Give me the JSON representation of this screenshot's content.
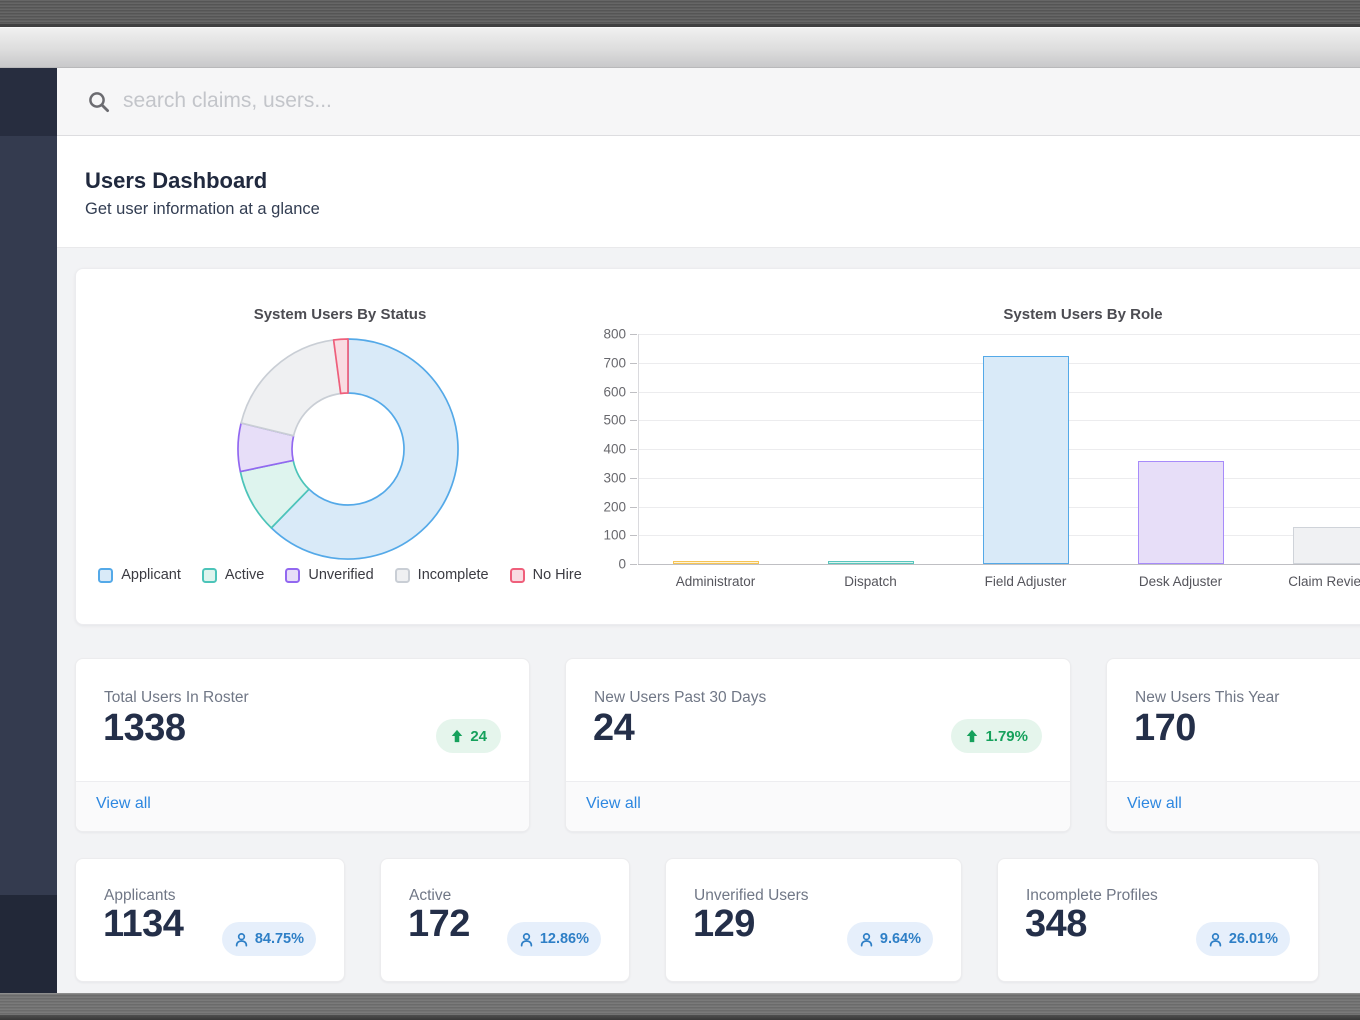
{
  "window": {
    "search_placeholder": "search claims, users..."
  },
  "page_header": {
    "title": "Users Dashboard",
    "subtitle": "Get user information at a glance"
  },
  "chart_data": [
    {
      "type": "pie",
      "donut": true,
      "title": "System Users By Status",
      "legend_position": "bottom",
      "slices": [
        {
          "label": "Applicant",
          "value": 1134,
          "fill": "#d9eaf8",
          "border": "#54a9e8"
        },
        {
          "label": "Active",
          "value": 172,
          "fill": "#def4ee",
          "border": "#4cc4b9"
        },
        {
          "label": "Unverified",
          "value": 129,
          "fill": "#e7def8",
          "border": "#9268f0"
        },
        {
          "label": "Incomplete",
          "value": 348,
          "fill": "#eff0f2",
          "border": "#c9ced5"
        },
        {
          "label": "No Hire",
          "value": 38,
          "fill": "#f9dce2",
          "border": "#ef5f7b"
        }
      ]
    },
    {
      "type": "bar",
      "title": "System Users By Role",
      "categories": [
        "Administrator",
        "Dispatch",
        "Field Adjuster",
        "Desk Adjuster",
        "Claim Reviewer"
      ],
      "values": [
        10,
        8,
        725,
        358,
        128
      ],
      "ylim": [
        0,
        800
      ],
      "ytick_step": 100,
      "grid": true,
      "bar_colors": [
        {
          "fill": "#fdf3d9",
          "border": "#f6c454"
        },
        {
          "fill": "#def4ef",
          "border": "#59c6bd"
        },
        {
          "fill": "#d9eaf8",
          "border": "#54a9e8"
        },
        {
          "fill": "#e7def8",
          "border": "#a78bfa"
        },
        {
          "fill": "#f0f1f3",
          "border": "#cfd3d9"
        }
      ]
    }
  ],
  "stat_cards_primary": [
    {
      "label": "Total Users In Roster",
      "value": "1338",
      "badge": {
        "type": "up",
        "text": "24"
      },
      "link": "View all"
    },
    {
      "label": "New Users Past 30 Days",
      "value": "24",
      "badge": {
        "type": "up",
        "text": "1.79%"
      },
      "link": "View all"
    },
    {
      "label": "New Users This Year",
      "value": "170",
      "link": "View all"
    }
  ],
  "stat_cards_secondary": [
    {
      "label": "Applicants",
      "value": "1134",
      "badge": {
        "type": "user",
        "text": "84.75%"
      }
    },
    {
      "label": "Active",
      "value": "172",
      "badge": {
        "type": "user",
        "text": "12.86%"
      }
    },
    {
      "label": "Unverified Users",
      "value": "129",
      "badge": {
        "type": "user",
        "text": "9.64%"
      }
    },
    {
      "label": "Incomplete Profiles",
      "value": "348",
      "badge": {
        "type": "user",
        "text": "26.01%"
      }
    }
  ],
  "colors": {
    "badge_up_bg": "#e5f5ec",
    "badge_up_text": "#16a15c",
    "badge_user_bg": "#e6effb",
    "badge_user_text": "#2e7fc6",
    "link": "#2d87e0",
    "sidebar": "#343b4f",
    "accent_blue": "#54a9e8"
  }
}
